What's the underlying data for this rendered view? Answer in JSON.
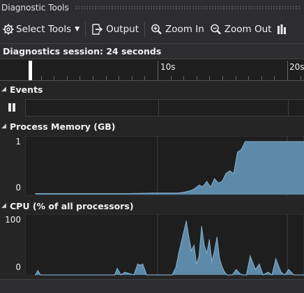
{
  "window": {
    "title": "Diagnostic Tools"
  },
  "toolbar": {
    "select_tools_label": "Select Tools",
    "output_label": "Output",
    "zoom_in_label": "Zoom In",
    "zoom_out_label": "Zoom Out"
  },
  "session": {
    "text": "Diagnostics session: 24 seconds"
  },
  "timeline": {
    "labels": [
      "10s",
      "20s"
    ],
    "selection_position_seconds": 1.3
  },
  "sections": {
    "events": {
      "title": "Events"
    },
    "memory": {
      "title": "Process Memory (GB)",
      "y_max_label": "1",
      "y_min_label": "0"
    },
    "cpu": {
      "title": "CPU (% of all processors)",
      "y_max_label": "100",
      "y_min_label": "0"
    }
  },
  "colors": {
    "graph_fill": "#5d8aa8",
    "graph_line": "#86b3d1",
    "background": "#252526",
    "plot_background": "#1e1e1e"
  },
  "chart_data": [
    {
      "type": "area",
      "title": "Process Memory (GB)",
      "x_unit": "s",
      "xlim": [
        0,
        21.8
      ],
      "ylim": [
        0,
        1
      ],
      "x": [
        0.8,
        2,
        4,
        6,
        8,
        10,
        12,
        12.5,
        13,
        13.3,
        13.6,
        13.9,
        14.2,
        14.5,
        14.8,
        15.1,
        15.4,
        15.7,
        16.0,
        16.3,
        16.6,
        16.9,
        17.2,
        17.5,
        18,
        19,
        20,
        21,
        21.8
      ],
      "values": [
        0.02,
        0.02,
        0.02,
        0.02,
        0.02,
        0.03,
        0.03,
        0.05,
        0.08,
        0.12,
        0.18,
        0.15,
        0.25,
        0.14,
        0.3,
        0.22,
        0.25,
        0.4,
        0.45,
        0.4,
        0.8,
        0.85,
        1.0,
        1.0,
        1.0,
        1.0,
        1.0,
        1.0,
        1.0
      ]
    },
    {
      "type": "area",
      "title": "CPU (% of all processors)",
      "x_unit": "s",
      "xlim": [
        0,
        21.8
      ],
      "ylim": [
        0,
        100
      ],
      "x": [
        0.8,
        1.0,
        1.2,
        2,
        4,
        6,
        7.0,
        7.2,
        7.5,
        7.8,
        8.5,
        8.8,
        9.0,
        9.2,
        9.5,
        10,
        10.5,
        11,
        11.5,
        11.8,
        12.0,
        12.2,
        12.4,
        12.6,
        12.8,
        13.0,
        13.2,
        13.4,
        13.6,
        13.8,
        14.0,
        14.2,
        14.4,
        14.6,
        14.8,
        15.0,
        15.2,
        15.4,
        15.6,
        15.8,
        16.0,
        16.2,
        16.5,
        16.8,
        17.0,
        17.3,
        17.6,
        18,
        18.3,
        18.6,
        19,
        19.3,
        19.6,
        20,
        20.3,
        20.6,
        21,
        21.8
      ],
      "values": [
        0,
        8,
        0,
        0,
        0,
        0,
        0,
        12,
        0,
        5,
        0,
        20,
        18,
        20,
        0,
        0,
        0,
        0,
        0,
        15,
        40,
        60,
        80,
        100,
        70,
        45,
        55,
        20,
        35,
        90,
        55,
        40,
        65,
        25,
        45,
        70,
        30,
        15,
        5,
        0,
        0,
        0,
        10,
        2,
        0,
        0,
        35,
        10,
        20,
        0,
        5,
        0,
        30,
        5,
        0,
        10,
        0,
        0
      ]
    }
  ]
}
